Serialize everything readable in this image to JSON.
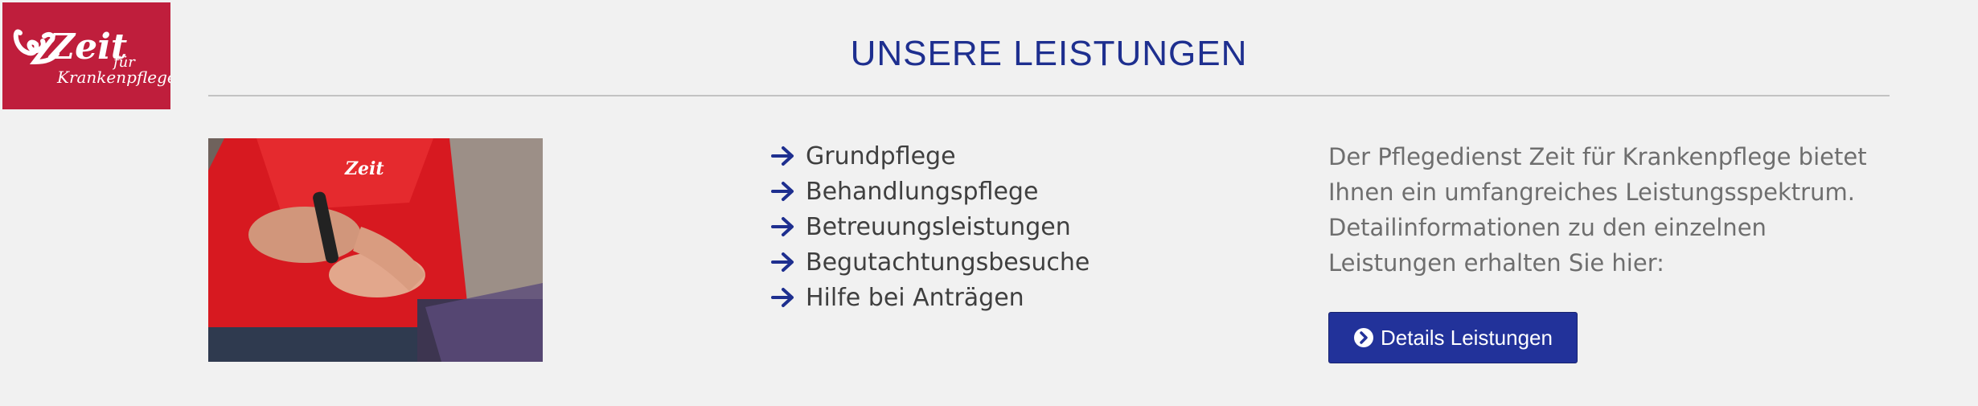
{
  "logo": {
    "word": "Zeit",
    "small_1": "für",
    "small_2": "Krankenpflege",
    "background": "#bf1e3c"
  },
  "section": {
    "title": "UNSERE LEISTUNGEN"
  },
  "image": {
    "description_icon": "photo-caregiver-blood-sugar-test"
  },
  "services": [
    {
      "label": "Grundpflege",
      "icon": "arrow-right-icon"
    },
    {
      "label": "Behandlungspflege",
      "icon": "arrow-right-icon"
    },
    {
      "label": "Betreuungsleistungen",
      "icon": "arrow-right-icon"
    },
    {
      "label": "Begutachtungsbesuche",
      "icon": "arrow-right-icon"
    },
    {
      "label": "Hilfe bei Anträgen",
      "icon": "arrow-right-icon"
    }
  ],
  "intro": {
    "line1": "Der Pflegedienst Zeit für Krankenpflege bietet",
    "line2": "Ihnen ein umfangreiches Leistungsspektrum.",
    "line3": "Detailinformationen zu den einzelnen",
    "line4": "Leistungen erhalten Sie hier:"
  },
  "button": {
    "label": "Details Leistungen",
    "icon": "chevron-circle-right-icon"
  },
  "colors": {
    "accent": "#1e2f8f",
    "button": "#22329a",
    "text": "#3f3f3f",
    "muted": "#6e6e6e",
    "brand": "#bf1e3c"
  }
}
